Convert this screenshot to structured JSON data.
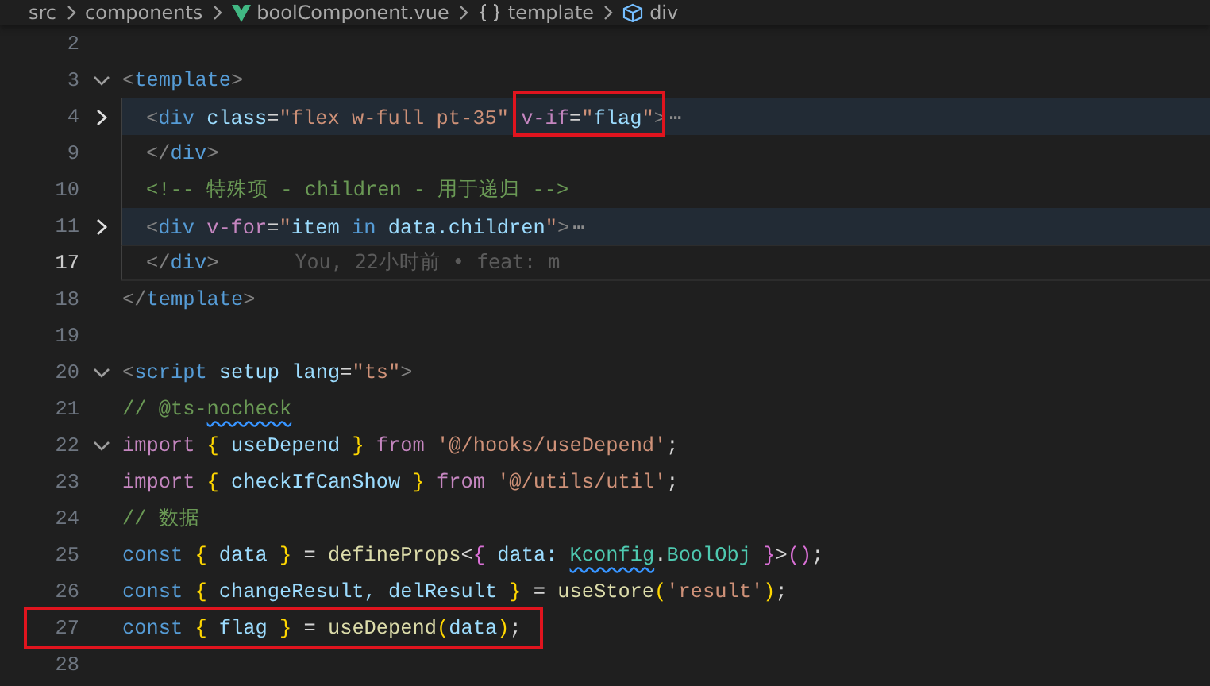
{
  "breadcrumb": [
    {
      "label": "src",
      "kind": "folder"
    },
    {
      "label": "components",
      "kind": "folder"
    },
    {
      "label": "boolComponent.vue",
      "kind": "file"
    },
    {
      "label": "template",
      "kind": "section"
    },
    {
      "label": "div",
      "kind": "element"
    }
  ],
  "lines": [
    {
      "number": "2",
      "active": false
    },
    {
      "number": "3",
      "active": false,
      "expanded": true,
      "segments": [
        {
          "text": "<",
          "kind": "punct"
        },
        {
          "text": "template",
          "kind": "tag"
        },
        {
          "text": ">",
          "kind": "punct"
        }
      ],
      "children": [
        {
          "number": "4",
          "active": false,
          "expanded": false,
          "segments": [
            {
              "text": "<",
              "kind": "punct"
            },
            {
              "text": "div",
              "kind": "tag"
            },
            {
              "text": " class",
              "kind": "attr"
            },
            {
              "text": "=",
              "kind": "plain"
            },
            {
              "text": "\"flex w-full pt-35\" ",
              "kind": "str"
            },
            {
              "kind": "group",
              "boxed": true,
              "segments": [
                {
                  "text": "v-if",
                  "kind": "directive"
                },
                {
                  "text": "=",
                  "kind": "plain"
                },
                {
                  "text": "\"",
                  "kind": "str"
                },
                {
                  "text": "flag",
                  "kind": "var"
                },
                {
                  "text": "\"",
                  "kind": "str"
                },
                {
                  "text": ">",
                  "kind": "punct"
                }
              ]
            },
            {
              "text": "⋯",
              "kind": "fold"
            }
          ]
        },
        {
          "number": "9",
          "active": false,
          "segments": [
            {
              "text": "</",
              "kind": "punct"
            },
            {
              "text": "div",
              "kind": "tag"
            },
            {
              "text": ">",
              "kind": "punct"
            }
          ]
        },
        {
          "number": "10",
          "active": false,
          "segments": [
            {
              "text": "<!-- 特殊项 - children - 用于递归 -->",
              "kind": "comment"
            }
          ]
        },
        {
          "number": "11",
          "active": false,
          "expanded": false,
          "segments": [
            {
              "text": "<",
              "kind": "punct"
            },
            {
              "text": "div",
              "kind": "tag"
            },
            {
              "text": " v-for",
              "kind": "directive"
            },
            {
              "text": "=",
              "kind": "plain"
            },
            {
              "text": "\"",
              "kind": "str"
            },
            {
              "text": "item",
              "kind": "var"
            },
            {
              "text": " in ",
              "kind": "tag"
            },
            {
              "text": "data.children",
              "kind": "var"
            },
            {
              "text": "\"",
              "kind": "str"
            },
            {
              "text": ">",
              "kind": "punct"
            },
            {
              "text": "⋯",
              "kind": "fold"
            }
          ]
        },
        {
          "number": "17",
          "active": true,
          "segments": [
            {
              "text": "</",
              "kind": "punct"
            },
            {
              "text": "div",
              "kind": "tag"
            },
            {
              "text": ">",
              "kind": "punct"
            }
          ],
          "blame": "You, 22小时前 • feat: m"
        }
      ]
    },
    {
      "number": "18",
      "active": false,
      "segments": [
        {
          "text": "</",
          "kind": "punct"
        },
        {
          "text": "template",
          "kind": "tag"
        },
        {
          "text": ">",
          "kind": "punct"
        }
      ]
    },
    {
      "number": "19",
      "active": false
    },
    {
      "number": "20",
      "active": false,
      "expanded": true,
      "segments": [
        {
          "text": "<",
          "kind": "punct"
        },
        {
          "text": "script",
          "kind": "tag"
        },
        {
          "text": " setup lang",
          "kind": "attr"
        },
        {
          "text": "=",
          "kind": "plain"
        },
        {
          "text": "\"ts\"",
          "kind": "str"
        },
        {
          "text": ">",
          "kind": "punct"
        }
      ]
    },
    {
      "number": "21",
      "active": false,
      "segments": [
        {
          "text": "// @ts-",
          "kind": "comment"
        },
        {
          "text": "nocheck",
          "kind": "comment",
          "warning": true
        }
      ]
    },
    {
      "number": "22",
      "active": false,
      "expanded": true,
      "segments": [
        {
          "text": "import ",
          "kind": "ctrl"
        },
        {
          "text": "{",
          "kind": "brace"
        },
        {
          "text": " useDepend ",
          "kind": "var"
        },
        {
          "text": "}",
          "kind": "brace"
        },
        {
          "text": " from ",
          "kind": "ctrl"
        },
        {
          "text": "'@/hooks/useDepend'",
          "kind": "str"
        },
        {
          "text": ";",
          "kind": "plain"
        }
      ]
    },
    {
      "number": "23",
      "active": false,
      "segments": [
        {
          "text": "import ",
          "kind": "ctrl"
        },
        {
          "text": "{",
          "kind": "brace"
        },
        {
          "text": " checkIfCanShow ",
          "kind": "var"
        },
        {
          "text": "}",
          "kind": "brace"
        },
        {
          "text": " from ",
          "kind": "ctrl"
        },
        {
          "text": "'@/utils/util'",
          "kind": "str"
        },
        {
          "text": ";",
          "kind": "plain"
        }
      ]
    },
    {
      "number": "24",
      "active": false,
      "segments": [
        {
          "text": "// 数据",
          "kind": "comment"
        }
      ]
    },
    {
      "number": "25",
      "active": false,
      "segments": [
        {
          "text": "const ",
          "kind": "tag"
        },
        {
          "text": "{",
          "kind": "brace"
        },
        {
          "text": " data ",
          "kind": "var"
        },
        {
          "text": "}",
          "kind": "brace"
        },
        {
          "text": " = ",
          "kind": "plain"
        },
        {
          "text": "defineProps",
          "kind": "fn"
        },
        {
          "text": "<",
          "kind": "plain"
        },
        {
          "text": "{",
          "kind": "brace2"
        },
        {
          "text": " data: ",
          "kind": "var"
        },
        {
          "text": "Kconfig",
          "kind": "type",
          "warning": true
        },
        {
          "text": ".",
          "kind": "plain"
        },
        {
          "text": "BoolObj ",
          "kind": "type"
        },
        {
          "text": "}",
          "kind": "brace2"
        },
        {
          "text": ">",
          "kind": "plain"
        },
        {
          "text": "()",
          "kind": "brace2"
        },
        {
          "text": ";",
          "kind": "plain"
        }
      ]
    },
    {
      "number": "26",
      "active": false,
      "segments": [
        {
          "text": "const ",
          "kind": "tag"
        },
        {
          "text": "{",
          "kind": "brace"
        },
        {
          "text": " changeResult, delResult ",
          "kind": "var"
        },
        {
          "text": "}",
          "kind": "brace"
        },
        {
          "text": " = ",
          "kind": "plain"
        },
        {
          "text": "useStore",
          "kind": "fn"
        },
        {
          "text": "(",
          "kind": "brace"
        },
        {
          "text": "'result'",
          "kind": "str"
        },
        {
          "text": ")",
          "kind": "brace"
        },
        {
          "text": ";",
          "kind": "plain"
        }
      ]
    },
    {
      "number": "27",
      "active": false,
      "boxed": true,
      "segments": [
        {
          "text": "const ",
          "kind": "tag"
        },
        {
          "text": "{",
          "kind": "brace"
        },
        {
          "text": " flag ",
          "kind": "var"
        },
        {
          "text": "}",
          "kind": "brace"
        },
        {
          "text": " = ",
          "kind": "plain"
        },
        {
          "text": "useDepend",
          "kind": "fn"
        },
        {
          "text": "(",
          "kind": "brace"
        },
        {
          "text": "data",
          "kind": "var"
        },
        {
          "text": ")",
          "kind": "brace"
        },
        {
          "text": ";",
          "kind": "plain"
        }
      ]
    },
    {
      "number": "28",
      "active": false
    }
  ]
}
